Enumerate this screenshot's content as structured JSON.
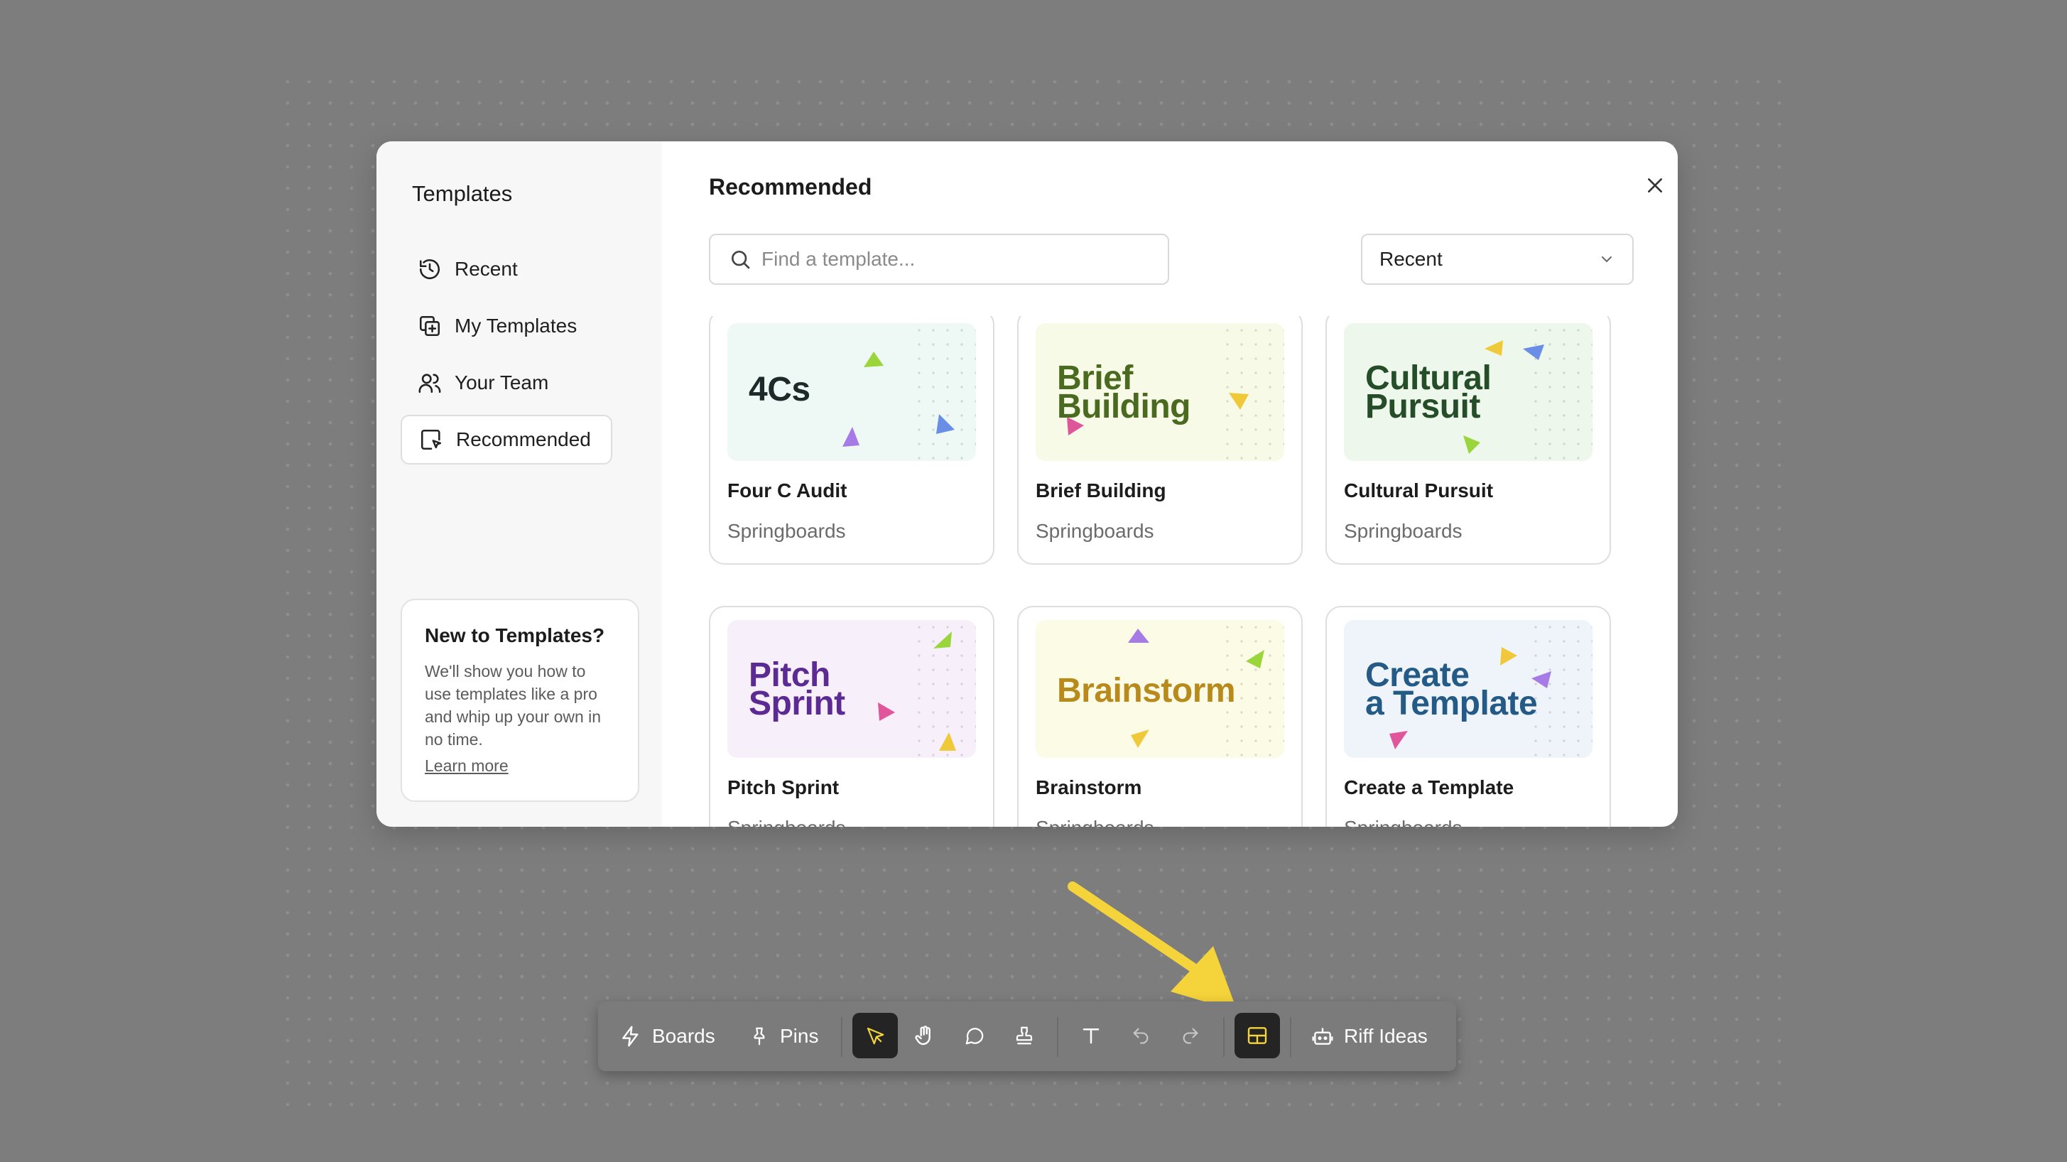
{
  "sidebar": {
    "title": "Templates",
    "items": [
      {
        "label": "Recent",
        "icon": "history-icon"
      },
      {
        "label": "My Templates",
        "icon": "templates-copy-icon"
      },
      {
        "label": "Your Team",
        "icon": "users-icon"
      },
      {
        "label": "Recommended",
        "icon": "recommended-icon",
        "active": true
      }
    ],
    "help": {
      "title": "New to Templates?",
      "body": "We'll show you how to use templates like a pro and whip up your own in no time.",
      "link": "Learn more"
    }
  },
  "main": {
    "title": "Recommended",
    "search_placeholder": "Find a template...",
    "sort_value": "Recent"
  },
  "templates": [
    {
      "name": "Four C Audit",
      "category": "Springboards",
      "thumb_lines": [
        "4Cs"
      ],
      "thumb_bg": "#eef8f4",
      "thumb_color": "#1e2a2a"
    },
    {
      "name": "Brief Building",
      "category": "Springboards",
      "thumb_lines": [
        "Brief",
        "Building"
      ],
      "thumb_bg": "#f6fae6",
      "thumb_color": "#4a6b1f"
    },
    {
      "name": "Cultural Pursuit",
      "category": "Springboards",
      "thumb_lines": [
        "Cultural",
        "Pursuit"
      ],
      "thumb_bg": "#eef7ec",
      "thumb_color": "#244d28"
    },
    {
      "name": "Pitch Sprint",
      "category": "Springboards",
      "thumb_lines": [
        "Pitch",
        "Sprint"
      ],
      "thumb_bg": "#f7f0fb",
      "thumb_color": "#5b2a93"
    },
    {
      "name": "Brainstorm",
      "category": "Springboards",
      "thumb_lines": [
        "Brainstorm"
      ],
      "thumb_bg": "#fbfbe6",
      "thumb_color": "#b78a1b"
    },
    {
      "name": "Create a Template",
      "category": "Springboards",
      "thumb_lines": [
        "Create",
        "a Template"
      ],
      "thumb_bg": "#eef4fa",
      "thumb_color": "#245a86"
    }
  ],
  "toolbar": {
    "boards": "Boards",
    "pins": "Pins",
    "riff": "Riff Ideas",
    "tools": [
      "select-icon",
      "hand-icon",
      "comment-icon",
      "stamp-icon",
      "text-icon",
      "undo-icon",
      "redo-icon",
      "templates-grid-icon"
    ]
  },
  "colors": {
    "accent_yellow": "#f5d33a",
    "tool_active_bg": "#242424"
  }
}
